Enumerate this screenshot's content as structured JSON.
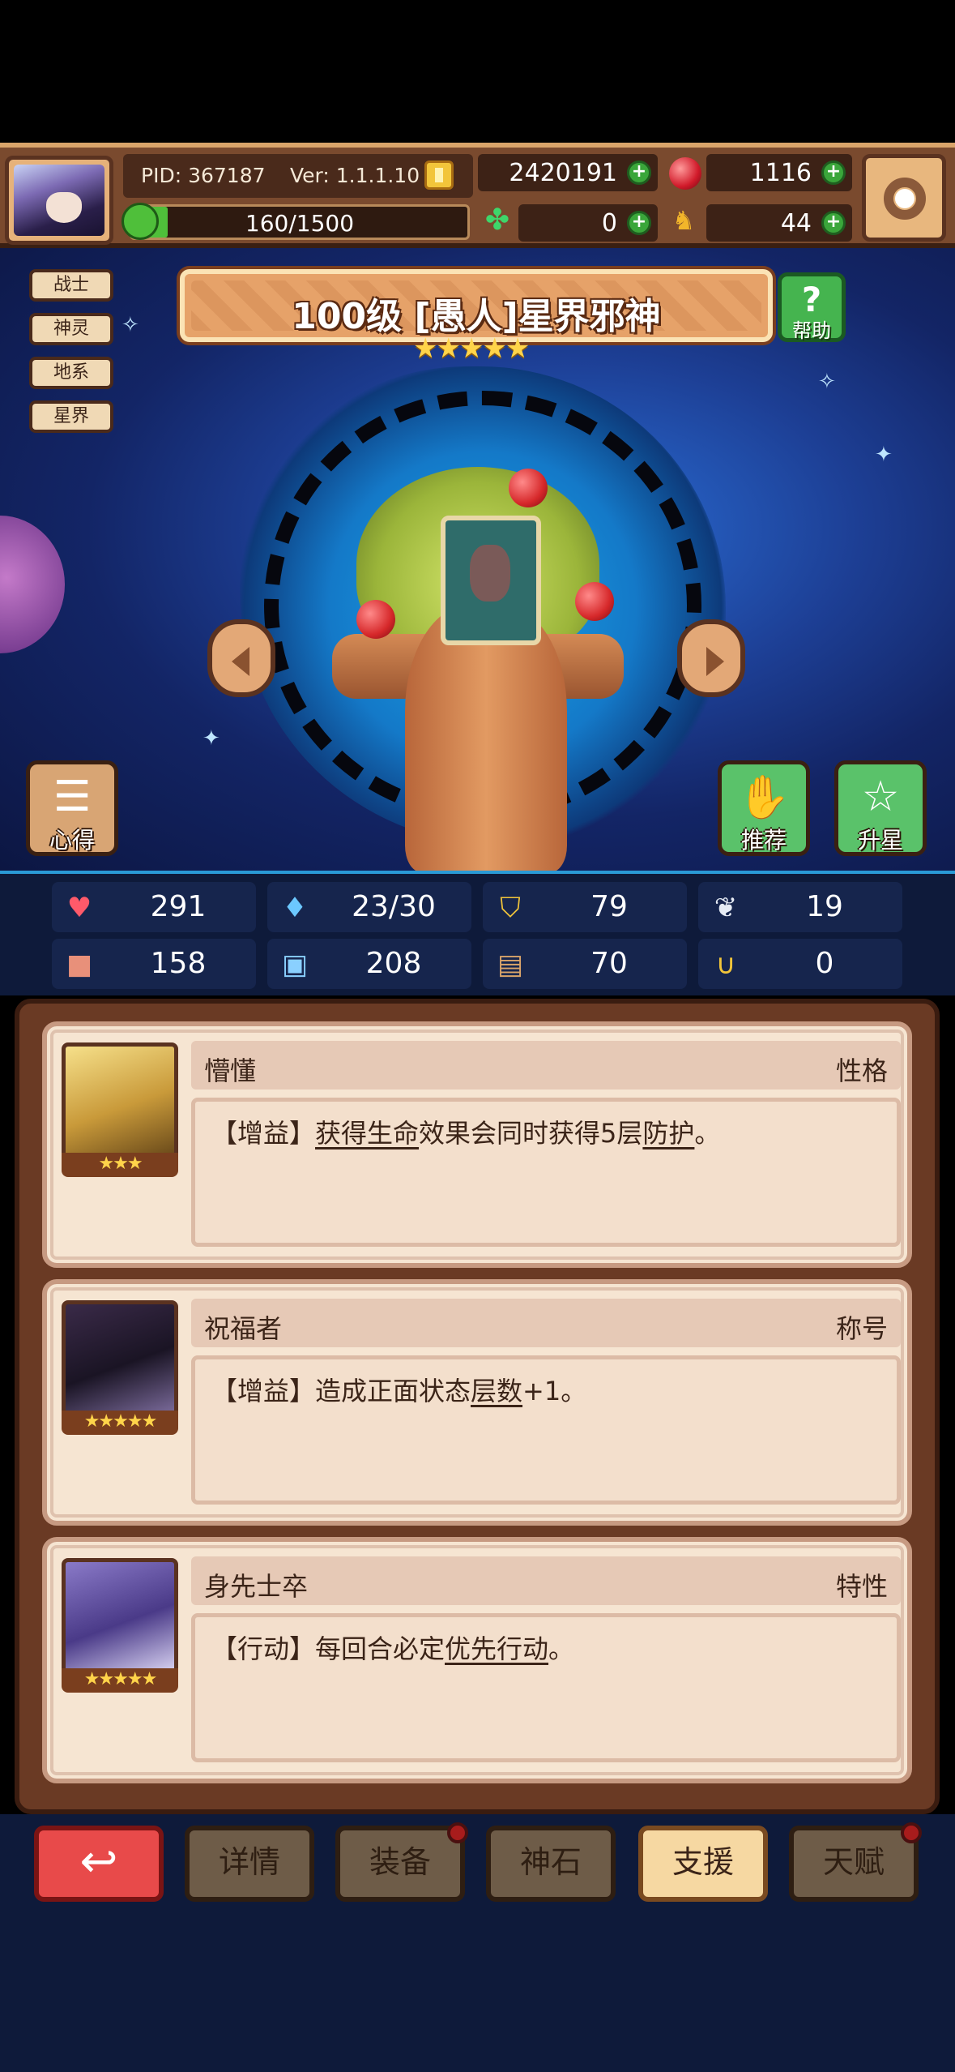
{
  "header": {
    "pid": "PID: 367187",
    "version": "Ver: 1.1.1.10",
    "gold": "2420191",
    "gems": "1116",
    "stamina": "160/1500",
    "stamina_ratio": 0.107,
    "clover": "0",
    "trophy": "44"
  },
  "class_tags": [
    "战士",
    "神灵",
    "地系",
    "星界"
  ],
  "boss": {
    "title": "100级  [愚人]星界邪神",
    "stars": "★★★★★",
    "help_label": "帮助"
  },
  "side_buttons": {
    "xinde": "心得",
    "tuijian": "推荐",
    "shengxing": "升星"
  },
  "stats": [
    {
      "icon": "heart-icon",
      "value": "291"
    },
    {
      "icon": "water-drop-icon",
      "value": "23/30"
    },
    {
      "icon": "shield-icon",
      "value": "79"
    },
    {
      "icon": "wing-icon",
      "value": "19"
    },
    {
      "icon": "fist-icon",
      "value": "158"
    },
    {
      "icon": "book-icon",
      "value": "208"
    },
    {
      "icon": "tome-icon",
      "value": "70"
    },
    {
      "icon": "horseshoe-icon",
      "value": "0"
    }
  ],
  "cards": [
    {
      "name": "懵懂",
      "kind": "性格",
      "stars": "★★★",
      "desc_prefix": "【增益】",
      "desc_link1": "获得生命",
      "desc_mid": "效果会同时获得5层",
      "desc_link2": "防护",
      "desc_suffix": "。"
    },
    {
      "name": "祝福者",
      "kind": "称号",
      "stars": "★★★★★",
      "desc_prefix": "【增益】造成正面状态",
      "desc_link1": "层数",
      "desc_mid": "+1。",
      "desc_link2": "",
      "desc_suffix": ""
    },
    {
      "name": "身先士卒",
      "kind": "特性",
      "stars": "★★★★★",
      "desc_prefix": "【行动】每回合必定",
      "desc_link1": "优先行动",
      "desc_mid": "。",
      "desc_link2": "",
      "desc_suffix": ""
    }
  ],
  "nav": {
    "back": "↩",
    "details": "详情",
    "equipment": "装备",
    "divine_stone": "神石",
    "support": "支援",
    "talent": "天赋"
  },
  "colors": {
    "accent_green": "#45b44f",
    "back_red": "#e84a4a",
    "active_tab": "#f6d8a2"
  }
}
